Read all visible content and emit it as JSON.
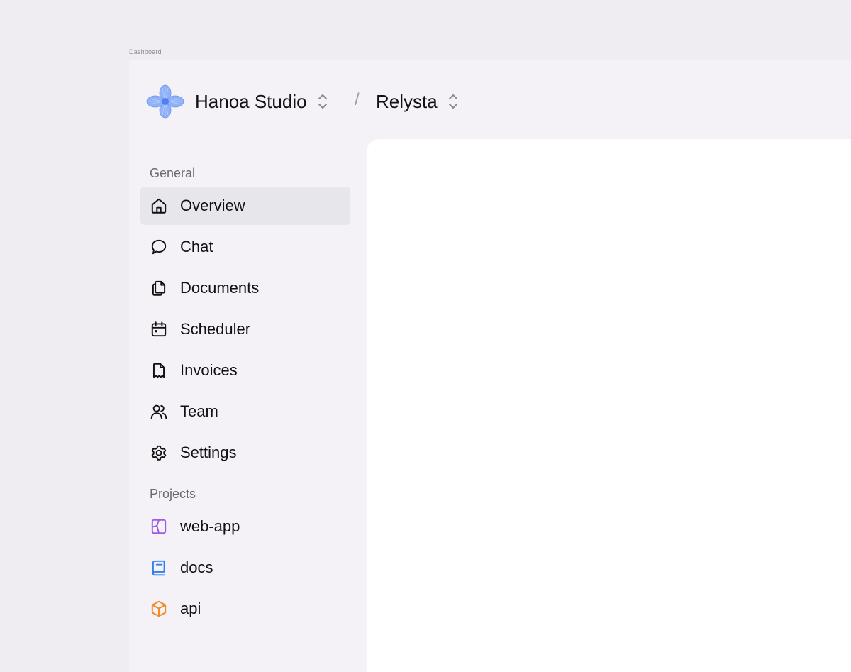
{
  "frame": {
    "label": "Dashboard"
  },
  "header": {
    "org_name": "Hanoa Studio",
    "separator": "/",
    "project_name": "Relysta",
    "logo_color": "#7fa6f5"
  },
  "sidebar": {
    "general_label": "General",
    "general_items": [
      {
        "label": "Overview",
        "icon": "home-icon",
        "active": true
      },
      {
        "label": "Chat",
        "icon": "chat-bubble-icon"
      },
      {
        "label": "Documents",
        "icon": "documents-icon"
      },
      {
        "label": "Scheduler",
        "icon": "calendar-icon"
      },
      {
        "label": "Invoices",
        "icon": "invoice-icon"
      },
      {
        "label": "Team",
        "icon": "users-icon"
      },
      {
        "label": "Settings",
        "icon": "gear-icon"
      }
    ],
    "projects_label": "Projects",
    "project_items": [
      {
        "label": "web-app",
        "icon": "layout-icon",
        "color": "#9b5de5"
      },
      {
        "label": "docs",
        "icon": "book-icon",
        "color": "#2f80ed"
      },
      {
        "label": "api",
        "icon": "cube-icon",
        "color": "#f08a24"
      }
    ]
  }
}
